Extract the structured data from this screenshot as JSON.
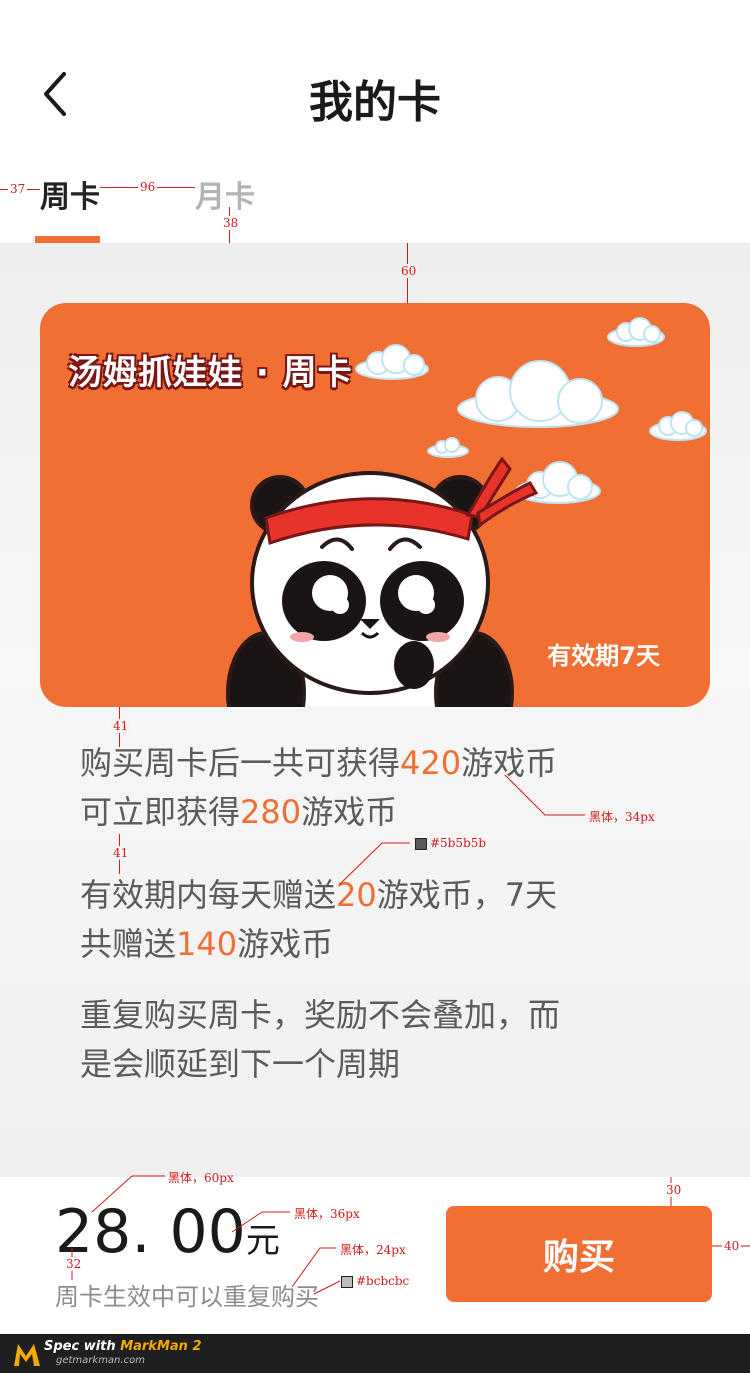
{
  "header": {
    "title": "我的卡",
    "back_icon": "chevron-left-icon"
  },
  "tabs": [
    {
      "label": "周卡",
      "selected": true
    },
    {
      "label": "月卡",
      "selected": false
    }
  ],
  "card": {
    "title": "汤姆抓娃娃 · 周卡",
    "validity": "有效期7天",
    "background": "#f26f34",
    "mascot": "panda-illustration"
  },
  "description": {
    "p1": {
      "a": "购买周卡后一共可获得",
      "n1": "420",
      "b": "游戏币",
      "c": "可立即获得",
      "n2": "280",
      "d": "游戏币"
    },
    "p2": {
      "a": "有效期内每天赠送",
      "n1": "20",
      "b": "游戏币，7天",
      "c": "共赠送",
      "n2": "140",
      "d": "游戏币"
    },
    "p3": {
      "line1": "重复购买周卡，奖励不会叠加，而",
      "line2": "是会顺延到下一个周期"
    }
  },
  "footer": {
    "price": "28. 00",
    "currency": "元",
    "note": "周卡生效中可以重复购买",
    "buy_label": "购买"
  },
  "annotations": {
    "a37": "37",
    "a96": "96",
    "a38": "38",
    "a60": "60",
    "a41a": "41",
    "a41b": "41",
    "font34": "黑体，34px",
    "color5b": "#5b5b5b",
    "font60": "黑体，60px",
    "font36": "黑体，36px",
    "font24": "黑体，24px",
    "colorbc": "#bcbcbc",
    "a30": "30",
    "a40": "40",
    "a32": "32"
  },
  "markman": {
    "brand": "Spec with",
    "brand2": "MarkMan 2",
    "url": "getmarkman.com"
  },
  "colors": {
    "accent": "#f26f34",
    "text": "#5b5b5b",
    "muted": "#bcbcbc",
    "annotation": "#d11a1a"
  }
}
